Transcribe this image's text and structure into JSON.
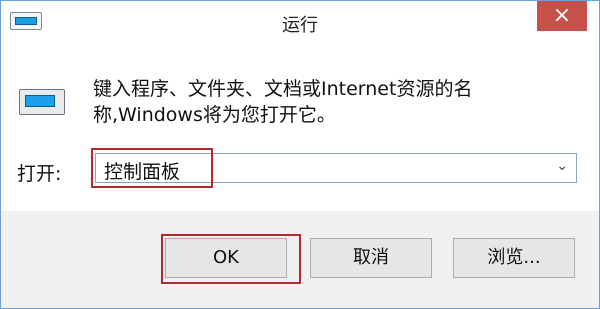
{
  "window": {
    "title": "运行",
    "close_label": "×"
  },
  "content": {
    "description": "键入程序、文件夹、文档或Internet资源的名称,Windows将为您打开它。",
    "open_label": "打开:",
    "open_value": "控制面板"
  },
  "buttons": {
    "ok_label": "OK",
    "cancel_label": "取消",
    "browse_label": "浏览..."
  },
  "icons": {
    "app_icon": "run-dialog-icon",
    "dialog_icon": "run-program-icon",
    "close_icon": "close-icon",
    "dropdown_icon": "chevron-down-icon"
  },
  "colors": {
    "close_button": "#c7504b",
    "highlight_border": "#b02a2a",
    "footer_background": "#f0f0f0"
  }
}
